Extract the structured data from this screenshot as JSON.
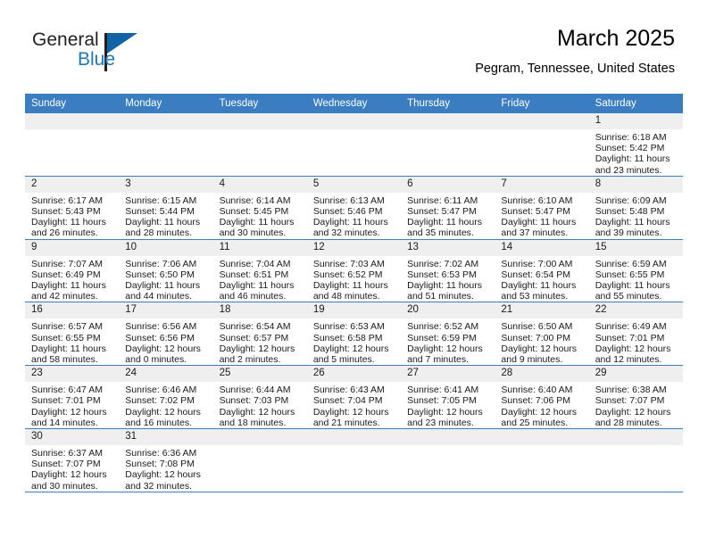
{
  "brand": {
    "name_top": "General",
    "name_bottom": "Blue",
    "logo_flag_color": "#1063a5",
    "logo_text_color": "#1879bf"
  },
  "header": {
    "title": "March 2025",
    "location": "Pegram, Tennessee, United States",
    "accent_color": "#3b7dc1"
  },
  "calendar": {
    "weekdays": [
      "Sunday",
      "Monday",
      "Tuesday",
      "Wednesday",
      "Thursday",
      "Friday",
      "Saturday"
    ],
    "labels": {
      "sunrise": "Sunrise:",
      "sunset": "Sunset:",
      "daylight": "Daylight:"
    },
    "weeks": [
      [
        {
          "day": ""
        },
        {
          "day": ""
        },
        {
          "day": ""
        },
        {
          "day": ""
        },
        {
          "day": ""
        },
        {
          "day": ""
        },
        {
          "day": "1",
          "sunrise": "Sunrise: 6:18 AM",
          "sunset": "Sunset: 5:42 PM",
          "daylight": "Daylight: 11 hours and 23 minutes."
        }
      ],
      [
        {
          "day": "2",
          "sunrise": "Sunrise: 6:17 AM",
          "sunset": "Sunset: 5:43 PM",
          "daylight": "Daylight: 11 hours and 26 minutes."
        },
        {
          "day": "3",
          "sunrise": "Sunrise: 6:15 AM",
          "sunset": "Sunset: 5:44 PM",
          "daylight": "Daylight: 11 hours and 28 minutes."
        },
        {
          "day": "4",
          "sunrise": "Sunrise: 6:14 AM",
          "sunset": "Sunset: 5:45 PM",
          "daylight": "Daylight: 11 hours and 30 minutes."
        },
        {
          "day": "5",
          "sunrise": "Sunrise: 6:13 AM",
          "sunset": "Sunset: 5:46 PM",
          "daylight": "Daylight: 11 hours and 32 minutes."
        },
        {
          "day": "6",
          "sunrise": "Sunrise: 6:11 AM",
          "sunset": "Sunset: 5:47 PM",
          "daylight": "Daylight: 11 hours and 35 minutes."
        },
        {
          "day": "7",
          "sunrise": "Sunrise: 6:10 AM",
          "sunset": "Sunset: 5:47 PM",
          "daylight": "Daylight: 11 hours and 37 minutes."
        },
        {
          "day": "8",
          "sunrise": "Sunrise: 6:09 AM",
          "sunset": "Sunset: 5:48 PM",
          "daylight": "Daylight: 11 hours and 39 minutes."
        }
      ],
      [
        {
          "day": "9",
          "sunrise": "Sunrise: 7:07 AM",
          "sunset": "Sunset: 6:49 PM",
          "daylight": "Daylight: 11 hours and 42 minutes."
        },
        {
          "day": "10",
          "sunrise": "Sunrise: 7:06 AM",
          "sunset": "Sunset: 6:50 PM",
          "daylight": "Daylight: 11 hours and 44 minutes."
        },
        {
          "day": "11",
          "sunrise": "Sunrise: 7:04 AM",
          "sunset": "Sunset: 6:51 PM",
          "daylight": "Daylight: 11 hours and 46 minutes."
        },
        {
          "day": "12",
          "sunrise": "Sunrise: 7:03 AM",
          "sunset": "Sunset: 6:52 PM",
          "daylight": "Daylight: 11 hours and 48 minutes."
        },
        {
          "day": "13",
          "sunrise": "Sunrise: 7:02 AM",
          "sunset": "Sunset: 6:53 PM",
          "daylight": "Daylight: 11 hours and 51 minutes."
        },
        {
          "day": "14",
          "sunrise": "Sunrise: 7:00 AM",
          "sunset": "Sunset: 6:54 PM",
          "daylight": "Daylight: 11 hours and 53 minutes."
        },
        {
          "day": "15",
          "sunrise": "Sunrise: 6:59 AM",
          "sunset": "Sunset: 6:55 PM",
          "daylight": "Daylight: 11 hours and 55 minutes."
        }
      ],
      [
        {
          "day": "16",
          "sunrise": "Sunrise: 6:57 AM",
          "sunset": "Sunset: 6:55 PM",
          "daylight": "Daylight: 11 hours and 58 minutes."
        },
        {
          "day": "17",
          "sunrise": "Sunrise: 6:56 AM",
          "sunset": "Sunset: 6:56 PM",
          "daylight": "Daylight: 12 hours and 0 minutes."
        },
        {
          "day": "18",
          "sunrise": "Sunrise: 6:54 AM",
          "sunset": "Sunset: 6:57 PM",
          "daylight": "Daylight: 12 hours and 2 minutes."
        },
        {
          "day": "19",
          "sunrise": "Sunrise: 6:53 AM",
          "sunset": "Sunset: 6:58 PM",
          "daylight": "Daylight: 12 hours and 5 minutes."
        },
        {
          "day": "20",
          "sunrise": "Sunrise: 6:52 AM",
          "sunset": "Sunset: 6:59 PM",
          "daylight": "Daylight: 12 hours and 7 minutes."
        },
        {
          "day": "21",
          "sunrise": "Sunrise: 6:50 AM",
          "sunset": "Sunset: 7:00 PM",
          "daylight": "Daylight: 12 hours and 9 minutes."
        },
        {
          "day": "22",
          "sunrise": "Sunrise: 6:49 AM",
          "sunset": "Sunset: 7:01 PM",
          "daylight": "Daylight: 12 hours and 12 minutes."
        }
      ],
      [
        {
          "day": "23",
          "sunrise": "Sunrise: 6:47 AM",
          "sunset": "Sunset: 7:01 PM",
          "daylight": "Daylight: 12 hours and 14 minutes."
        },
        {
          "day": "24",
          "sunrise": "Sunrise: 6:46 AM",
          "sunset": "Sunset: 7:02 PM",
          "daylight": "Daylight: 12 hours and 16 minutes."
        },
        {
          "day": "25",
          "sunrise": "Sunrise: 6:44 AM",
          "sunset": "Sunset: 7:03 PM",
          "daylight": "Daylight: 12 hours and 18 minutes."
        },
        {
          "day": "26",
          "sunrise": "Sunrise: 6:43 AM",
          "sunset": "Sunset: 7:04 PM",
          "daylight": "Daylight: 12 hours and 21 minutes."
        },
        {
          "day": "27",
          "sunrise": "Sunrise: 6:41 AM",
          "sunset": "Sunset: 7:05 PM",
          "daylight": "Daylight: 12 hours and 23 minutes."
        },
        {
          "day": "28",
          "sunrise": "Sunrise: 6:40 AM",
          "sunset": "Sunset: 7:06 PM",
          "daylight": "Daylight: 12 hours and 25 minutes."
        },
        {
          "day": "29",
          "sunrise": "Sunrise: 6:38 AM",
          "sunset": "Sunset: 7:07 PM",
          "daylight": "Daylight: 12 hours and 28 minutes."
        }
      ],
      [
        {
          "day": "30",
          "sunrise": "Sunrise: 6:37 AM",
          "sunset": "Sunset: 7:07 PM",
          "daylight": "Daylight: 12 hours and 30 minutes."
        },
        {
          "day": "31",
          "sunrise": "Sunrise: 6:36 AM",
          "sunset": "Sunset: 7:08 PM",
          "daylight": "Daylight: 12 hours and 32 minutes."
        },
        {
          "day": ""
        },
        {
          "day": ""
        },
        {
          "day": ""
        },
        {
          "day": ""
        },
        {
          "day": ""
        }
      ]
    ]
  }
}
